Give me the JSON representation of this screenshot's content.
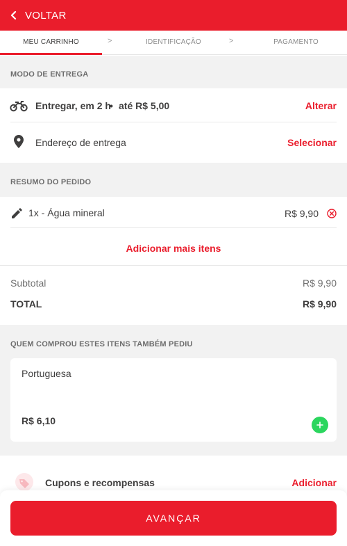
{
  "header": {
    "back_label": "VOLTAR"
  },
  "steps": [
    {
      "label": "MEU CARRINHO"
    },
    {
      "label": "IDENTIFICAÇÃO"
    },
    {
      "label": "PAGAMENTO"
    }
  ],
  "step_separator": ">",
  "delivery": {
    "section_title": "MODO DE ENTREGA",
    "mode_label": "Entregar, em 2 h",
    "bullet": "•",
    "fee_label": "até R$ 5,00",
    "change_label": "Alterar",
    "address_label": "Endereço de entrega",
    "select_label": "Selecionar"
  },
  "order": {
    "section_title": "RESUMO DO PEDIDO",
    "items": [
      {
        "description": "1x - Água mineral",
        "price": "R$ 9,90"
      }
    ],
    "add_more_label": "Adicionar mais itens",
    "subtotal_label": "Subtotal",
    "subtotal_value": "R$ 9,90",
    "total_label": "TOTAL",
    "total_value": "R$ 9,90"
  },
  "suggestions": {
    "section_title": "QUEM COMPROU ESTES ITENS TAMBÉM PEDIU",
    "items": [
      {
        "name": "Portuguesa",
        "price": "R$ 6,10"
      }
    ]
  },
  "coupons": {
    "label": "Cupons e recompensas",
    "action_label": "Adicionar"
  },
  "cta": {
    "label": "AVANÇAR"
  },
  "colors": {
    "brand_red": "#ea1d2c",
    "add_green": "#2bd65e",
    "section_bg": "#f2f2f2"
  },
  "icons": [
    "chevron-left-icon",
    "motorcycle-icon",
    "location-pin-icon",
    "pencil-icon",
    "remove-circle-icon",
    "plus-icon",
    "coupon-tag-icon"
  ]
}
